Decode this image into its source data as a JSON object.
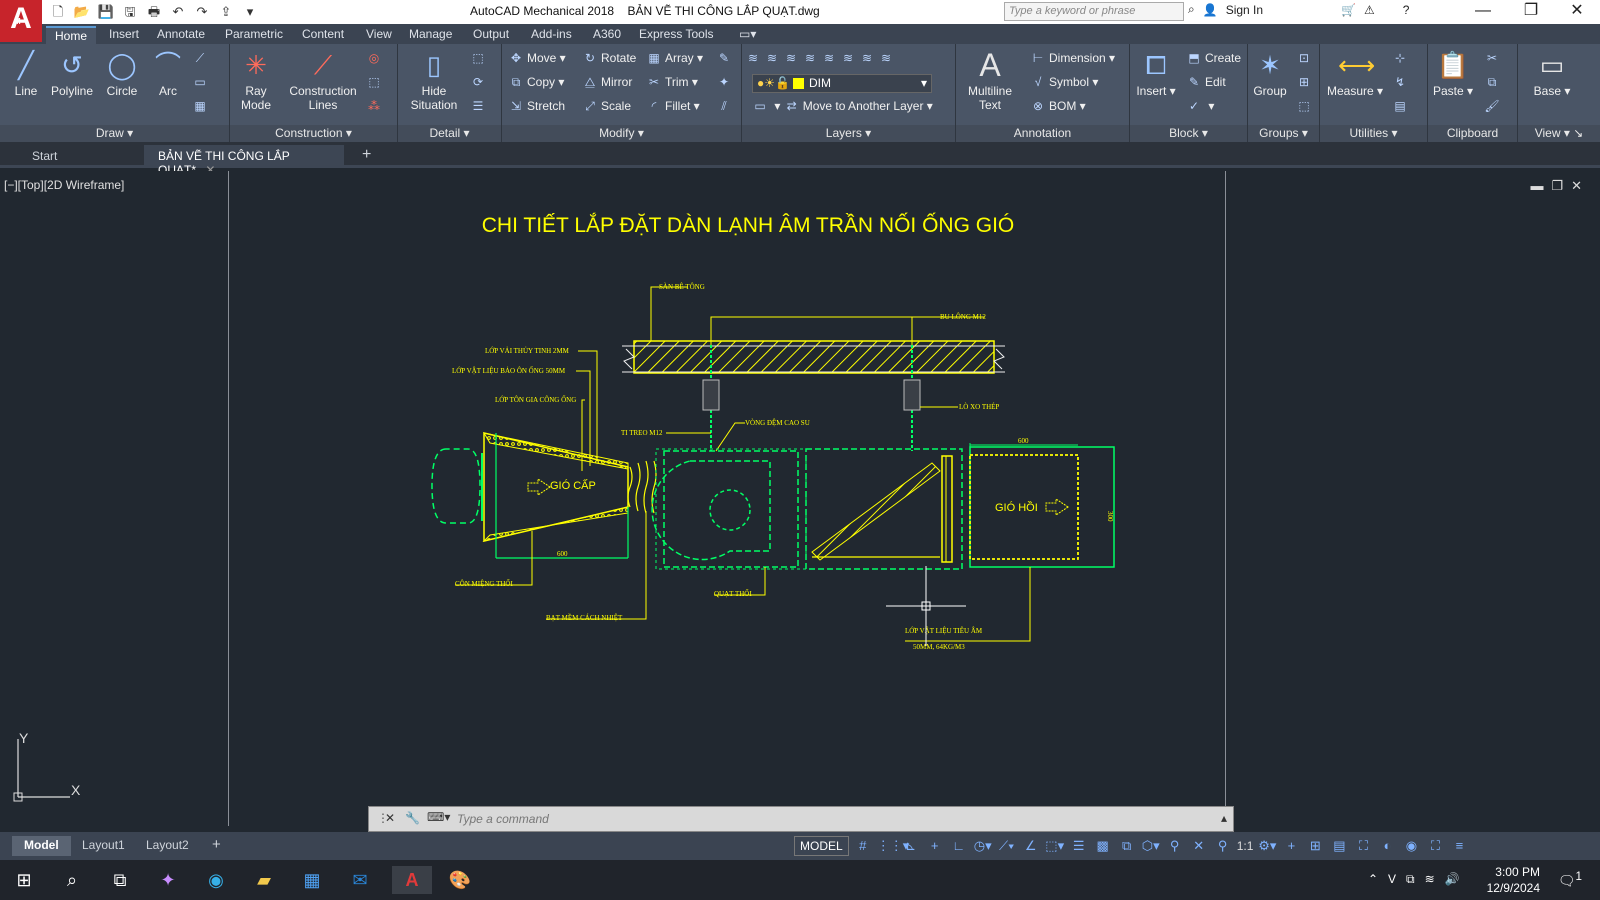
{
  "titlebar": {
    "app_name": "AutoCAD Mechanical 2018",
    "file_name": "BẢN VẼ THI CÔNG LẮP QUẠT.dwg",
    "search_placeholder": "Type a keyword or phrase",
    "sign_in": "Sign In"
  },
  "ribbon_tabs": [
    "Home",
    "Insert",
    "Annotate",
    "Parametric",
    "Content",
    "View",
    "Manage",
    "Output",
    "Add-ins",
    "A360",
    "Express Tools"
  ],
  "ribbon": {
    "draw": {
      "title": "Draw",
      "line": "Line",
      "polyline": "Polyline",
      "circle": "Circle",
      "arc": "Arc"
    },
    "construction": {
      "title": "Construction",
      "ray_mode_1": "Ray",
      "ray_mode_2": "Mode",
      "construction_lines_1": "Construction",
      "construction_lines_2": "Lines"
    },
    "detail": {
      "title": "Detail",
      "hide_1": "Hide",
      "hide_2": "Situation"
    },
    "modify": {
      "title": "Modify",
      "move": "Move",
      "rotate": "Rotate",
      "array": "Array",
      "copy": "Copy",
      "mirror": "Mirror",
      "trim": "Trim",
      "stretch": "Stretch",
      "scale": "Scale",
      "fillet": "Fillet"
    },
    "layers": {
      "title": "Layers",
      "current_layer": "DIM",
      "move_to_layer": "Move to Another Layer"
    },
    "annotation": {
      "title": "Annotation",
      "mtext_1": "Multiline",
      "mtext_2": "Text",
      "dimension": "Dimension",
      "symbol": "Symbol",
      "bom": "BOM"
    },
    "block": {
      "title": "Block",
      "insert": "Insert",
      "create": "Create",
      "edit": "Edit"
    },
    "groups": {
      "title": "Groups",
      "group": "Group"
    },
    "utilities": {
      "title": "Utilities",
      "measure": "Measure"
    },
    "clipboard": {
      "title": "Clipboard",
      "paste": "Paste"
    },
    "view": {
      "title": "View",
      "base": "Base"
    }
  },
  "doc_tabs": {
    "start": "Start",
    "active": "BẢN VẼ THI CÔNG LẮP QUẠT*"
  },
  "viewport": {
    "label": "[−][Top][2D Wireframe]"
  },
  "drawing": {
    "title": "CHI TIẾT LẮP ĐẶT DÀN LẠNH ÂM TRẦN NỐI ỐNG GIÓ",
    "labels": {
      "san_be_tong": "SÀN BÊ TÔNG",
      "bu_long": "BU LÔNG M12",
      "lop_vai": "LỚP VẢI THỦY TINH 2MM",
      "lop_vat_lieu": "LỚP VẬT LIỆU BẢO ÔN ỐNG 50MM",
      "lop_ton": "LỚP TÔN GIA CÔNG ỐNG",
      "lo_xo": "LÒ XO THÉP",
      "ti_treo": "TI TREO M12",
      "vong_dem": "VÒNG ĐỆM CAO SU",
      "gio_cap": "GIÓ CẤP",
      "gio_hoi": "GIÓ HỒI",
      "dim_600_left": "600",
      "dim_600_right": "600",
      "dim_300": "300",
      "con_mieng_thoi": "CÔN MIỆNG THỔI",
      "bat_mem": "BẠT MỀM CÁCH NHIỆT",
      "quat_thoi": "QUẠT THỔI",
      "lop_tieu_am_1": "LỚP VẬT LIỆU TIÊU ÂM",
      "lop_tieu_am_2": "50MM, 64KG/M3"
    }
  },
  "command": {
    "placeholder": "Type a command"
  },
  "layout_tabs": [
    "Model",
    "Layout1",
    "Layout2"
  ],
  "status": {
    "model": "MODEL",
    "scale": "1:1"
  },
  "taskbar": {
    "time": "3:00 PM",
    "date": "12/9/2024",
    "notif": "1"
  }
}
